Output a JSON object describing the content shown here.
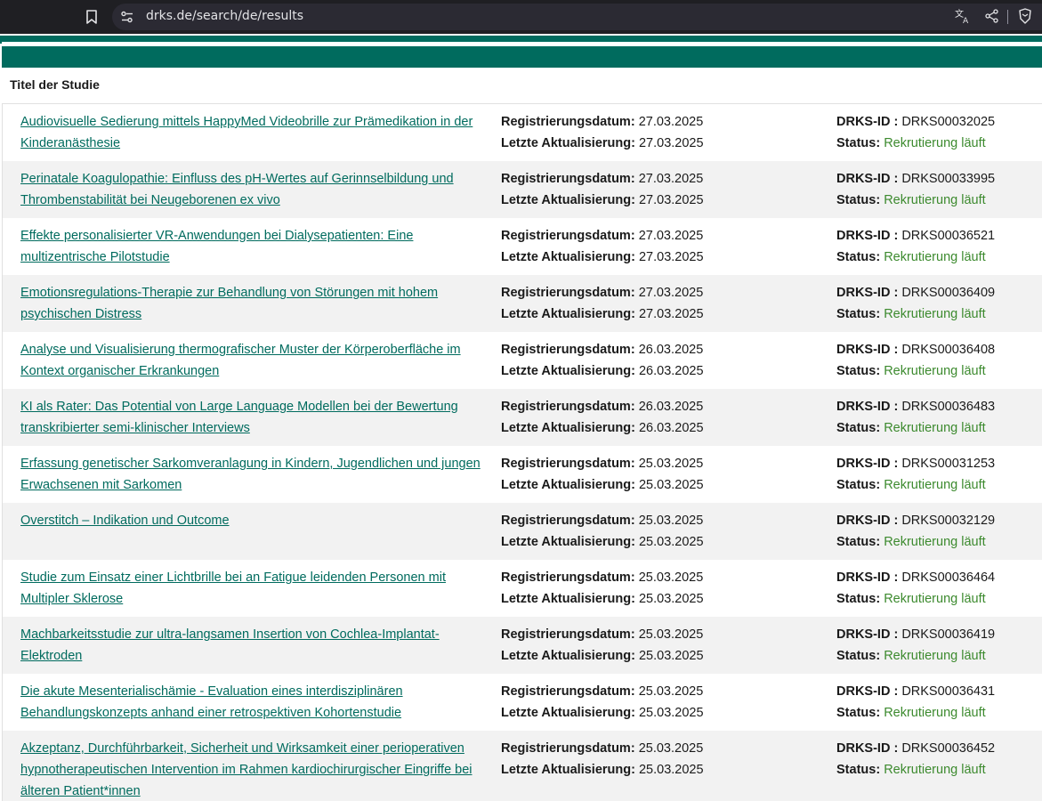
{
  "browser": {
    "url": "drks.de/search/de/results"
  },
  "table": {
    "column_header": "Titel der Studie",
    "labels": {
      "registration_date": "Registrierungsdatum:",
      "last_update": "Letzte Aktualisierung:",
      "drks_id": "DRKS-ID :",
      "status": "Status:"
    },
    "rows": [
      {
        "title": "Audiovisuelle Sedierung mittels HappyMed Videobrille zur Prämedikation in der Kinderanästhesie",
        "registered": "27.03.2025",
        "updated": "27.03.2025",
        "id": "DRKS00032025",
        "status": "Rekrutierung läuft"
      },
      {
        "title": "Perinatale Koagulopathie: Einfluss des pH-Wertes auf Gerinnselbildung und Thrombenstabilität bei Neugeborenen ex vivo",
        "registered": "27.03.2025",
        "updated": "27.03.2025",
        "id": "DRKS00033995",
        "status": "Rekrutierung läuft"
      },
      {
        "title": "Effekte personalisierter VR-Anwendungen bei Dialysepatienten: Eine multizentrische Pilotstudie",
        "registered": "27.03.2025",
        "updated": "27.03.2025",
        "id": "DRKS00036521",
        "status": "Rekrutierung läuft"
      },
      {
        "title": "Emotionsregulations-Therapie zur Behandlung von Störungen mit hohem psychischen Distress",
        "registered": "27.03.2025",
        "updated": "27.03.2025",
        "id": "DRKS00036409",
        "status": "Rekrutierung läuft"
      },
      {
        "title": "Analyse und Visualisierung thermografischer Muster der Körperoberfläche im Kontext organischer Erkrankungen",
        "registered": "26.03.2025",
        "updated": "26.03.2025",
        "id": "DRKS00036408",
        "status": "Rekrutierung läuft"
      },
      {
        "title": "KI als Rater: Das Potential von Large Language Modellen bei der Bewertung transkribierter semi-klinischer Interviews",
        "registered": "26.03.2025",
        "updated": "26.03.2025",
        "id": "DRKS00036483",
        "status": "Rekrutierung läuft"
      },
      {
        "title": "Erfassung genetischer Sarkomveranlagung in Kindern, Jugendlichen und jungen Erwachsenen mit Sarkomen",
        "registered": "25.03.2025",
        "updated": "25.03.2025",
        "id": "DRKS00031253",
        "status": "Rekrutierung läuft"
      },
      {
        "title": "Overstitch – Indikation und Outcome",
        "registered": "25.03.2025",
        "updated": "25.03.2025",
        "id": "DRKS00032129",
        "status": "Rekrutierung läuft"
      },
      {
        "title": "Studie zum Einsatz einer Lichtbrille bei an Fatigue leidenden Personen mit Multipler Sklerose",
        "registered": "25.03.2025",
        "updated": "25.03.2025",
        "id": "DRKS00036464",
        "status": "Rekrutierung läuft"
      },
      {
        "title": "Machbarkeitsstudie zur ultra-langsamen Insertion von Cochlea-Implantat-Elektroden",
        "registered": "25.03.2025",
        "updated": "25.03.2025",
        "id": "DRKS00036419",
        "status": "Rekrutierung läuft"
      },
      {
        "title": "Die akute Mesenterialischämie - Evaluation eines interdisziplinären Behandlungskonzepts anhand einer retrospektiven Kohortenstudie",
        "registered": "25.03.2025",
        "updated": "25.03.2025",
        "id": "DRKS00036431",
        "status": "Rekrutierung läuft"
      },
      {
        "title": "Akzeptanz, Durchführbarkeit, Sicherheit und Wirksamkeit einer perioperativen hypnotherapeutischen Intervention im Rahmen kardiochirurgischer Eingriffe bei älteren Patient*innen",
        "registered": "25.03.2025",
        "updated": "25.03.2025",
        "id": "DRKS00036452",
        "status": "Rekrutierung läuft"
      }
    ]
  },
  "colors": {
    "brand_green": "#006b5e",
    "status_green": "#3c8a2e",
    "alt_row": "#f2f2f2"
  },
  "icons": [
    "bookmark-icon",
    "site-settings-icon",
    "translate-icon",
    "share-icon",
    "brave-shield-icon"
  ]
}
